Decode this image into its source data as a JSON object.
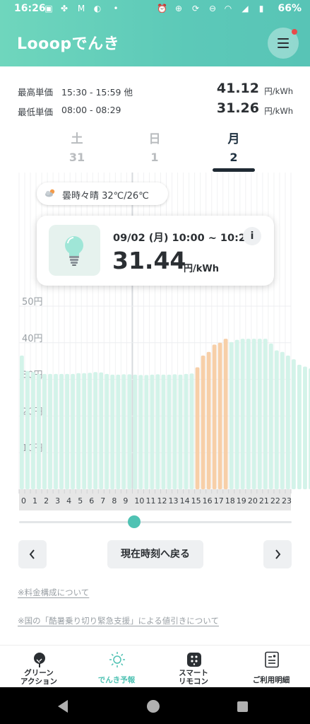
{
  "status_bar": {
    "time": "16:26",
    "battery": "66%"
  },
  "header": {
    "logo": "Looopでんき",
    "menu_icon": "hamburger-menu-icon",
    "has_notification": true,
    "brand_color": "#5cc9b8"
  },
  "price_summary": {
    "max": {
      "label": "最高単価",
      "range": "15:30 - 15:59 他",
      "value": "41.12",
      "unit": "円/kWh"
    },
    "min": {
      "label": "最低単価",
      "range": "08:00 - 08:29",
      "value": "31.26",
      "unit": "円/kWh"
    }
  },
  "day_tabs": [
    {
      "dow": "土",
      "num": "31",
      "active": false
    },
    {
      "dow": "日",
      "num": "1",
      "active": false
    },
    {
      "dow": "月",
      "num": "2",
      "active": true
    }
  ],
  "weather": {
    "icon": "cloudy-sunny-icon",
    "text": "曇時々晴  32℃/26℃"
  },
  "tooltip": {
    "date": "09/02 (月) 10:00 ~ 10:29",
    "value": "31.44",
    "unit": "円/kWh",
    "info": "i",
    "icon": "light-bulb-icon"
  },
  "chart_data": {
    "type": "bar",
    "yaxis_labels": [
      "50円",
      "40円",
      "30円",
      "20円",
      "10円"
    ],
    "ylim": [
      0,
      50
    ],
    "grid": true,
    "x": [
      "0",
      "1",
      "2",
      "3",
      "4",
      "5",
      "6",
      "7",
      "8",
      "9",
      "10",
      "11",
      "12",
      "13",
      "14",
      "15",
      "16",
      "17",
      "18",
      "19",
      "20",
      "21",
      "22",
      "23"
    ],
    "values": [
      36.5,
      32.3,
      32,
      31.5,
      31.5,
      31.5,
      31.5,
      31.5,
      31.5,
      31.5,
      31.7,
      31.7,
      31.8,
      32,
      31.9,
      31.5,
      31.3,
      31.3,
      31.4,
      31.4,
      31.3,
      31.2,
      31.2,
      31.3,
      31.4,
      31.3,
      31.3,
      31.4,
      31.3,
      31.5,
      31.6,
      33.3,
      36.5,
      37.5,
      39.5,
      40,
      41.1,
      40.2,
      40.8,
      41.1,
      41.1,
      41.1,
      41.1,
      41.1,
      39.8,
      37.9,
      37.5,
      36.5,
      35.5,
      34,
      33.5,
      33,
      32.8,
      32.4
    ],
    "half_hour_count": 48,
    "highlight_indices": [
      31,
      32,
      33,
      34,
      35,
      36
    ],
    "selected_hour": 10,
    "bar_color": "#d3f3e9",
    "highlight_color": "#f7cfa8",
    "axis_bar_color": "#e6e6e6"
  },
  "controls": {
    "prev_icon": "chevron-left-icon",
    "next_icon": "chevron-right-icon",
    "now_label": "現在時刻へ戻る"
  },
  "links": [
    "※料金構成について",
    "※国の「酷暑乗り切り緊急支援」による値引きについて"
  ],
  "bottom_nav": [
    {
      "label": "グリーン\nアクション",
      "icon": "tree-icon",
      "active": false
    },
    {
      "label": "でんき予報",
      "icon": "sun-icon",
      "active": true
    },
    {
      "label": "スマート\nリモコン",
      "icon": "remote-control-icon",
      "active": false
    },
    {
      "label": "ご利用明細",
      "icon": "bill-icon",
      "active": false
    }
  ],
  "system_nav": [
    "back-icon",
    "home-icon",
    "recents-icon"
  ]
}
